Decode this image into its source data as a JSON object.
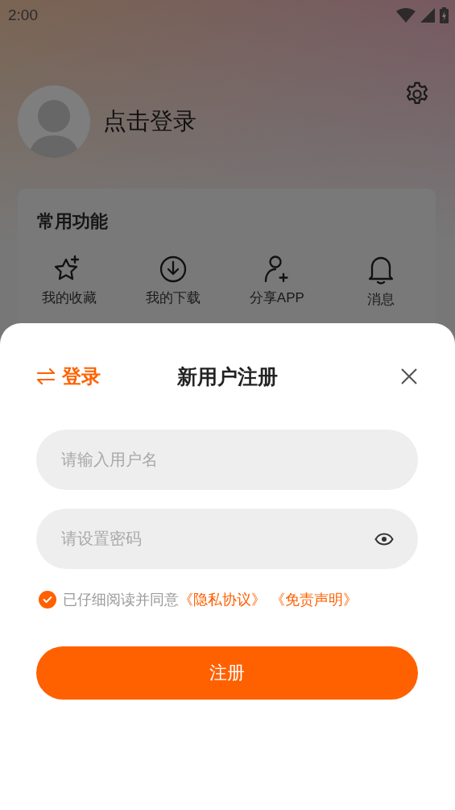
{
  "status_bar": {
    "time": "2:00"
  },
  "profile": {
    "login_text": "点击登录"
  },
  "functions": {
    "title": "常用功能",
    "items": [
      {
        "label": "我的收藏",
        "kind": "star"
      },
      {
        "label": "我的下载",
        "kind": "download"
      },
      {
        "label": "分享APP",
        "kind": "share"
      },
      {
        "label": "消息",
        "kind": "bell"
      }
    ]
  },
  "register_sheet": {
    "switch_label": "登录",
    "title": "新用户注册",
    "fields": [
      {
        "placeholder": "请输入用户名",
        "kind": "text"
      },
      {
        "placeholder": "请设置密码",
        "kind": "password"
      }
    ],
    "agreement": {
      "checked": true,
      "text": "已仔细阅读并同意",
      "links": [
        "《隐私协议》",
        "《免责声明》"
      ]
    },
    "submit_label": "注册"
  }
}
